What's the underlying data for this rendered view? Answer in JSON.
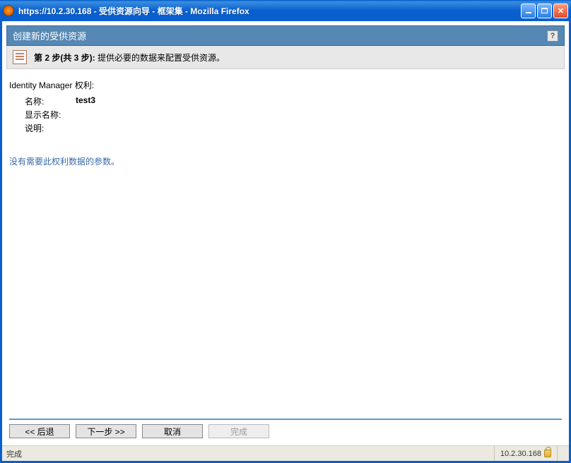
{
  "window": {
    "title": "https://10.2.30.168 - 受供资源向导 - 框架集 - Mozilla Firefox"
  },
  "wizard": {
    "header_title": "创建新的受供资源",
    "help_label": "?",
    "step_label_bold": "第 2 步(共 3 步):",
    "step_label_rest": " 提供必要的数据来配置受供资源。"
  },
  "entitlement": {
    "title": "Identity Manager 权利:",
    "fields": {
      "name_label": "名称:",
      "name_value": "test3",
      "display_name_label": "显示名称:",
      "display_name_value": "",
      "description_label": "说明:",
      "description_value": ""
    },
    "no_params_msg": "没有需要此权利数据的参数。"
  },
  "buttons": {
    "back": "<< 后退",
    "next": "下一步 >>",
    "cancel": "取消",
    "finish": "完成"
  },
  "statusbar": {
    "status_text": "完成",
    "host": "10.2.30.168"
  }
}
